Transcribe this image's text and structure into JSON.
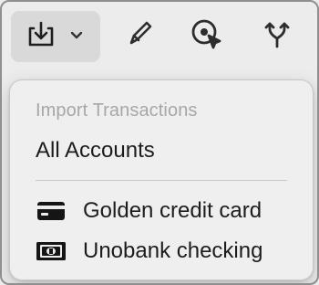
{
  "toolbar": {
    "buttons": [
      {
        "name": "import",
        "icon": "import-tray-icon",
        "has_dropdown": true
      },
      {
        "name": "edit",
        "icon": "pencil-icon"
      },
      {
        "name": "select",
        "icon": "target-cursor-icon"
      },
      {
        "name": "merge",
        "icon": "merge-branch-icon"
      }
    ]
  },
  "menu": {
    "header": "Import Transactions",
    "items": [
      {
        "label": "All Accounts"
      },
      {
        "label": "Golden credit card",
        "icon": "credit-card-icon"
      },
      {
        "label": "Unobank checking",
        "icon": "cash-icon"
      }
    ]
  },
  "colors": {
    "background": "#ececec",
    "menu_background": "#eeeeee",
    "header_text": "#a7a7a7",
    "item_text": "#1d1d1d",
    "active_toolbar_button": "#d9d9d9"
  }
}
